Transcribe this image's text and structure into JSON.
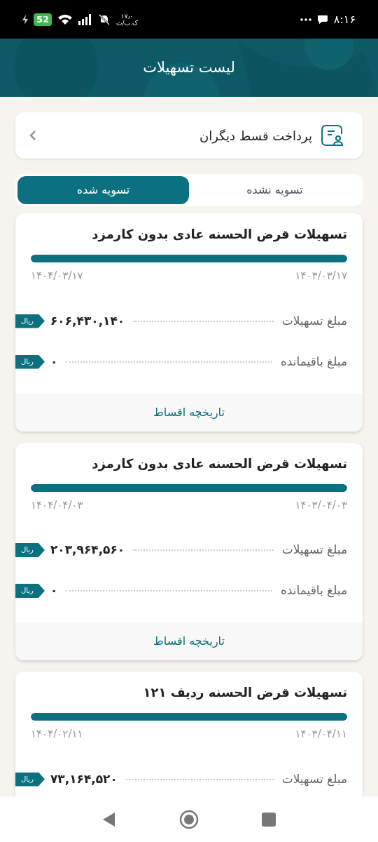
{
  "status_bar": {
    "battery": "52",
    "speed": "۱۷٫۰",
    "speed_unit": "ک.ب/ث",
    "time": "۸:۱۶"
  },
  "header": {
    "title": "لیست تسهیلات"
  },
  "pay_other": {
    "label": "پرداخت قسط دیگران"
  },
  "tabs": [
    {
      "label": "تسویه نشده",
      "selected": false
    },
    {
      "label": "تسویه شده",
      "selected": true
    }
  ],
  "loans": [
    {
      "title": "تسهیلات قرض الحسنه عادی بدون کارمزد",
      "level": 1,
      "start_date": "۱۴۰۳/۰۳/۱۷",
      "end_date": "۱۴۰۴/۰۳/۱۷",
      "rows": [
        {
          "label": "مبلغ تسهیلات",
          "value": "۶۰۶,۴۳۰,۱۴۰",
          "unit": "ریال"
        },
        {
          "label": "مبلغ باقیمانده",
          "value": "۰",
          "unit": "ریال"
        }
      ],
      "history": "تاریخچه اقساط"
    },
    {
      "title": "تسهیلات قرض الحسنه عادی بدون کارمزد",
      "level": 1,
      "start_date": "۱۴۰۳/۰۴/۰۳",
      "end_date": "۱۴۰۴/۰۴/۰۳",
      "rows": [
        {
          "label": "مبلغ تسهیلات",
          "value": "۲۰۳,۹۶۴,۵۶۰",
          "unit": "ریال"
        },
        {
          "label": "مبلغ باقیمانده",
          "value": "۰",
          "unit": "ریال"
        }
      ],
      "history": "تاریخچه اقساط"
    },
    {
      "title": "تسهیلات قرض الحسنه ردیف ۱۲۱",
      "level": 1,
      "start_date": "۱۴۰۳/۰۴/۱۱",
      "end_date": "۱۴۰۴/۰۲/۱۱",
      "rows": [
        {
          "label": "مبلغ تسهیلات",
          "value": "۷۳,۱۶۴,۵۲۰",
          "unit": "ریال"
        }
      ]
    }
  ]
}
